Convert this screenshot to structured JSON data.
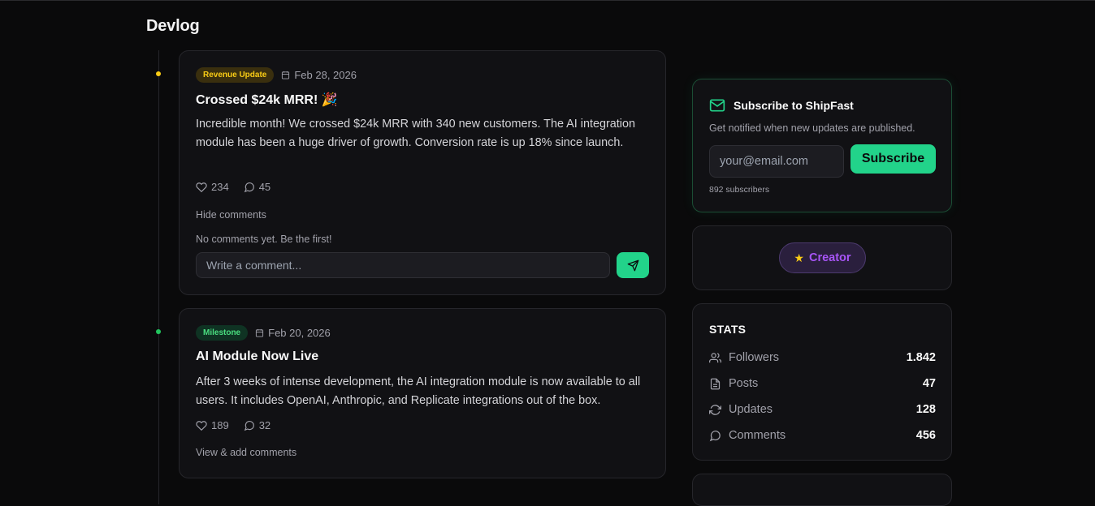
{
  "page": {
    "title": "Devlog"
  },
  "posts": [
    {
      "badge": "Revenue Update",
      "date": "Feb 28, 2026",
      "title": "Crossed $24k MRR! 🎉",
      "body": "Incredible month! We crossed $24k MRR with 340 new customers. The AI integration module has been a huge driver of growth. Conversion rate is up 18% since launch.",
      "likes": "234",
      "comments": "45",
      "toggle_label": "Hide comments",
      "empty_comments": "No comments yet. Be the first!",
      "comment_placeholder": "Write a comment..."
    },
    {
      "badge": "Milestone",
      "date": "Feb 20, 2026",
      "title": "AI Module Now Live",
      "body": "After 3 weeks of intense development, the AI integration module is now available to all users. It includes OpenAI, Anthropic, and Replicate integrations out of the box.",
      "likes": "189",
      "comments": "32",
      "toggle_label": "View & add comments"
    }
  ],
  "subscribe": {
    "title": "Subscribe to ShipFast",
    "description": "Get notified when new updates are published.",
    "email_placeholder": "your@email.com",
    "button_label": "Subscribe",
    "subscriber_count": "892 subscribers"
  },
  "creator": {
    "label": "Creator"
  },
  "stats": {
    "title": "STATS",
    "rows": [
      {
        "label": "Followers",
        "value": "1.842",
        "icon": "users-icon"
      },
      {
        "label": "Posts",
        "value": "47",
        "icon": "file-icon"
      },
      {
        "label": "Updates",
        "value": "128",
        "icon": "refresh-icon"
      },
      {
        "label": "Comments",
        "value": "456",
        "icon": "comment-icon"
      }
    ]
  },
  "colors": {
    "accent": "#22d38a",
    "revenue_badge": "#facc15",
    "milestone_badge": "#4ade80",
    "creator": "#a855f7"
  }
}
